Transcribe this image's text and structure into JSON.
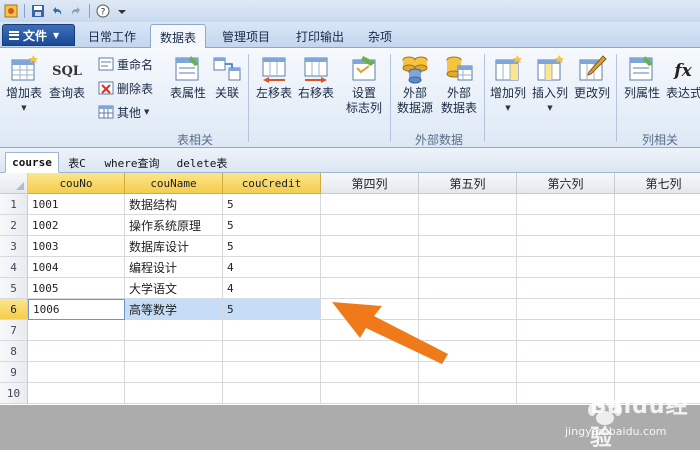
{
  "qat": {
    "icons": [
      "app-icon",
      "save-icon",
      "undo-icon",
      "redo-icon",
      "help-icon"
    ]
  },
  "ribbon_tabs": {
    "file_label": "文件",
    "tabs": [
      "日常工作",
      "数据表",
      "管理项目",
      "打印输出",
      "杂项"
    ],
    "active": "数据表"
  },
  "ribbon": {
    "add_table": "增加表",
    "query_table": "查询表",
    "rename": "重命名",
    "delete_table": "删除表",
    "other": "其他",
    "table_props": "表属性",
    "join": "关联",
    "move_left": "左移表",
    "move_right": "右移表",
    "set_flag_col_1": "设置",
    "set_flag_col_2": "标志列",
    "ext_source_1": "外部",
    "ext_source_2": "数据源",
    "ext_table_1": "外部",
    "ext_table_2": "数据表",
    "add_column": "增加列",
    "insert_column": "插入列",
    "change_column": "更改列",
    "column_props": "列属性",
    "expression": "表达式",
    "sql_icon_text": "SQL",
    "fx_icon_text": "fx",
    "group_table": "表相关",
    "group_external": "外部数据",
    "group_column": "列相关"
  },
  "doc_tabs": [
    "course",
    "表C",
    "where查询",
    "delete表"
  ],
  "grid": {
    "columns": [
      "couNo",
      "couName",
      "couCredit",
      "第四列",
      "第五列",
      "第六列",
      "第七列"
    ],
    "rows": [
      [
        "1001",
        "数据结构",
        "5"
      ],
      [
        "1002",
        "操作系统原理",
        "5"
      ],
      [
        "1003",
        "数据库设计",
        "5"
      ],
      [
        "1004",
        "编程设计",
        "4"
      ],
      [
        "1005",
        "大学语文",
        "4"
      ],
      [
        "1006",
        "高等数学",
        "5"
      ],
      [
        "",
        "",
        ""
      ],
      [
        "",
        "",
        ""
      ],
      [
        "",
        "",
        ""
      ],
      [
        "",
        "",
        ""
      ]
    ],
    "row_numbers": [
      "1",
      "2",
      "3",
      "4",
      "5",
      "6",
      "7",
      "8",
      "9",
      "10"
    ],
    "selected_row": 6
  },
  "watermark": {
    "logo_text": "Baidu经验",
    "url": "jingyan.baidu.com"
  },
  "colors": {
    "accent": "#f07a1a",
    "selected_row": "#c6ddf7",
    "header_yellow": "#f4cd4c"
  }
}
